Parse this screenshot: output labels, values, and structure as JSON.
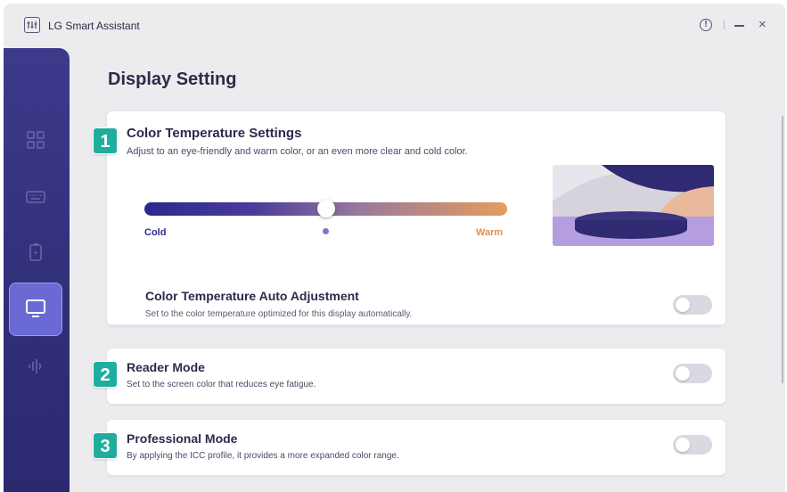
{
  "window": {
    "title": "LG Smart Assistant",
    "controls": {
      "info": "!",
      "close": "×"
    }
  },
  "sidebar": {
    "items": [
      {
        "name": "dashboard",
        "icon": "grid-icon",
        "active": false
      },
      {
        "name": "keyboard",
        "icon": "keyboard-icon",
        "active": false
      },
      {
        "name": "battery",
        "icon": "battery-icon",
        "active": false
      },
      {
        "name": "display",
        "icon": "monitor-icon",
        "active": true
      },
      {
        "name": "sound",
        "icon": "sound-icon",
        "active": false
      }
    ]
  },
  "page": {
    "title": "Display Setting"
  },
  "color_temperature": {
    "badge": "1",
    "title": "Color Temperature Settings",
    "description": "Adjust to an eye-friendly and warm color, or an even more clear and cold color.",
    "slider": {
      "min_label": "Cold",
      "max_label": "Warm",
      "value": 0.5,
      "default_marker": 0.5,
      "gradient_start": "#2a2a8c",
      "gradient_end": "#e59c5e"
    },
    "auto": {
      "title": "Color Temperature Auto Adjustment",
      "description": "Set to the color temperature optimized for this display automatically.",
      "enabled": false
    }
  },
  "reader_mode": {
    "badge": "2",
    "title": "Reader Mode",
    "description": "Set to the screen color that reduces eye fatigue.",
    "enabled": false
  },
  "professional_mode": {
    "badge": "3",
    "title": "Professional Mode",
    "description": "By applying the ICC profile, it provides a more expanded color range.",
    "enabled": false
  },
  "colors": {
    "accent": "#1fae9e",
    "sidebar": "#3d3a8c",
    "sidebar_active": "#6b69d4",
    "toggle_off": "#dad9e2"
  }
}
